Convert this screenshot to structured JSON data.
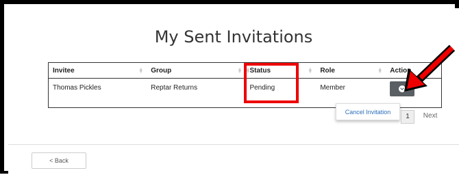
{
  "page": {
    "title": "My Sent Invitations"
  },
  "table": {
    "headers": [
      "Invitee",
      "Group",
      "Status",
      "Role",
      "Action"
    ],
    "rows": [
      {
        "invitee": "Thomas Pickles",
        "group": "Reptar Returns",
        "status": "Pending",
        "role": "Member"
      }
    ]
  },
  "dropdown": {
    "cancel_label": "Cancel Invitation"
  },
  "pagination": {
    "current": "1",
    "next_label": "Next"
  },
  "footer": {
    "back_label": "< Back"
  },
  "colors": {
    "highlight": "#e00000",
    "action_button": "#5a5f64",
    "link": "#2a6fba"
  },
  "icons": {
    "action": "chevron-down-circle-icon",
    "annotation": "red-arrow-icon"
  }
}
